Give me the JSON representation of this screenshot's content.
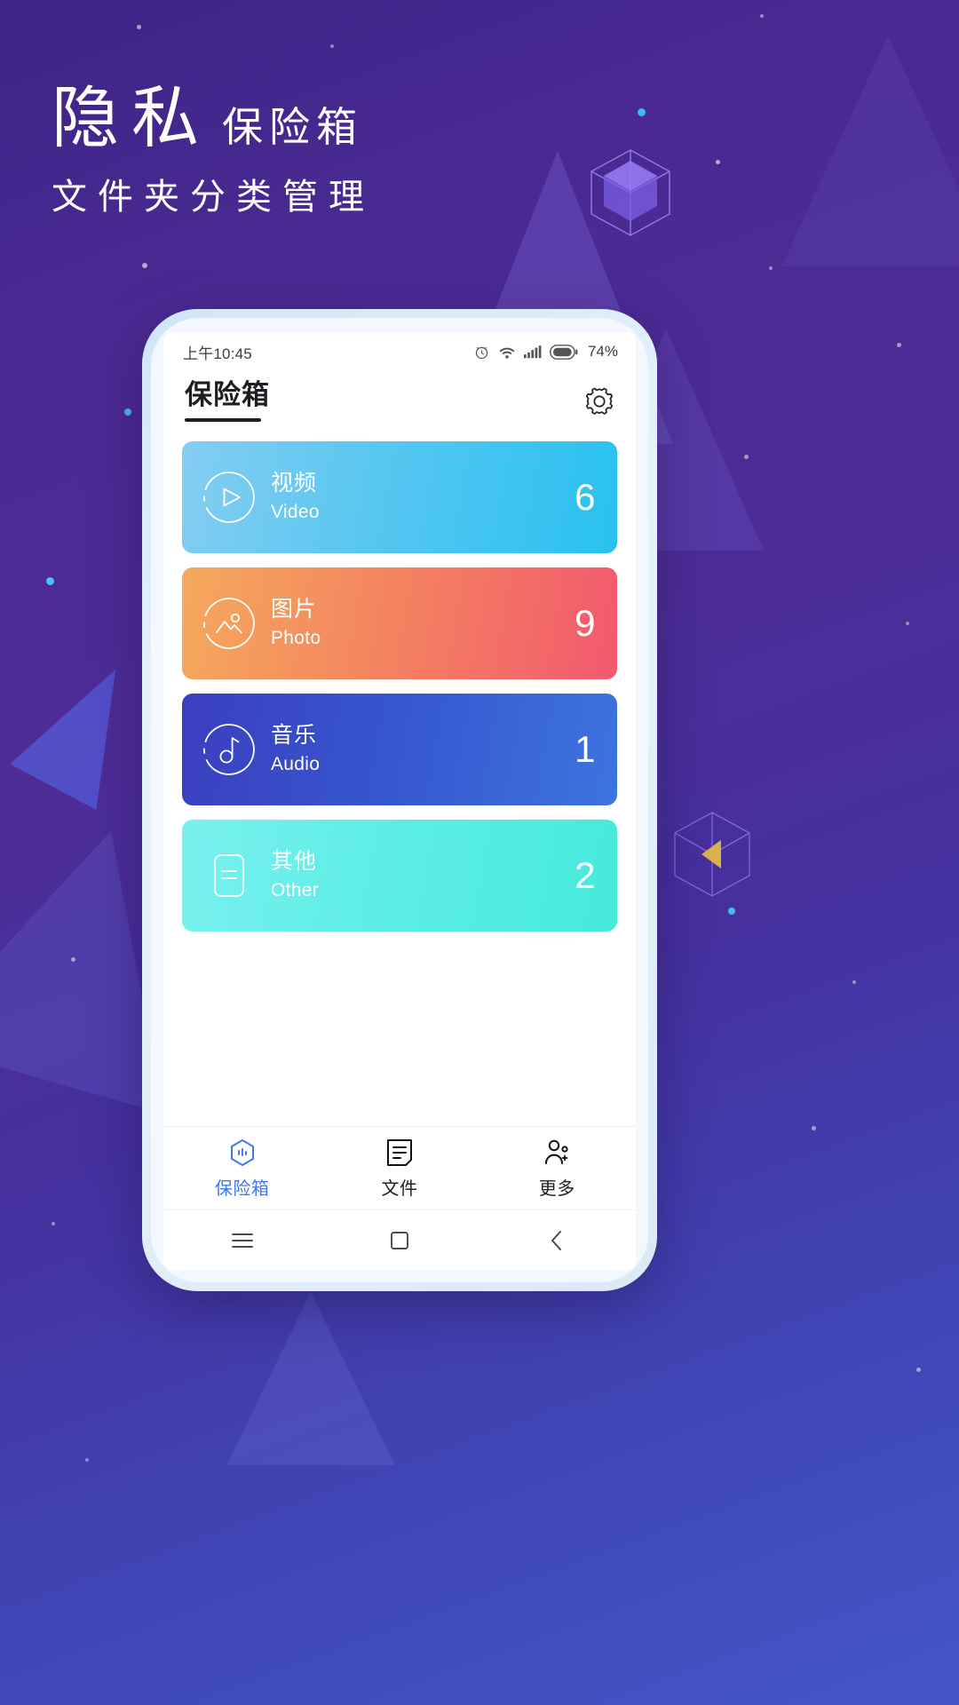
{
  "banner": {
    "headline_main": "隐私",
    "headline_sub": "保险箱",
    "subtitle": "文件夹分类管理",
    "accent_purple": "#4a2a92",
    "accent_blue": "#4356c9"
  },
  "phone": {
    "statusbar": {
      "time": "上午10:45",
      "alarm_icon": "alarm-clock-icon",
      "wifi_icon": "wifi-icon",
      "signal_icon": "cellular-signal-icon",
      "battery_icon": "battery-icon",
      "battery_text": "74%"
    },
    "header": {
      "title": "保险箱",
      "settings_icon": "gear-icon"
    },
    "cards": [
      {
        "name": "视频",
        "sub": "Video",
        "count": "6",
        "icon": "play-circle-icon",
        "color_start": "#85cdf2",
        "color_end": "#29c1ef"
      },
      {
        "name": "图片",
        "sub": "Photo",
        "count": "9",
        "icon": "image-circle-icon",
        "color_start": "#f5a95e",
        "color_end": "#f2596e"
      },
      {
        "name": "音乐",
        "sub": "Audio",
        "count": "1",
        "icon": "music-note-circle-icon",
        "color_start": "#3b3fbf",
        "color_end": "#3d74de"
      },
      {
        "name": "其他",
        "sub": "Other",
        "count": "2",
        "icon": "document-icon",
        "color_start": "#7af0ef",
        "color_end": "#46e9dd"
      }
    ],
    "tabbar": [
      {
        "label": "保险箱",
        "icon": "shield-vault-icon",
        "active": true,
        "active_color": "#3f78f0"
      },
      {
        "label": "文件",
        "icon": "file-lines-icon",
        "active": false,
        "active_color": "#202024"
      },
      {
        "label": "更多",
        "icon": "more-dots-icon",
        "active": false,
        "active_color": "#202024"
      }
    ],
    "navbar": [
      {
        "icon": "recents-menu-icon"
      },
      {
        "icon": "home-square-icon"
      },
      {
        "icon": "back-chevron-icon"
      }
    ]
  }
}
